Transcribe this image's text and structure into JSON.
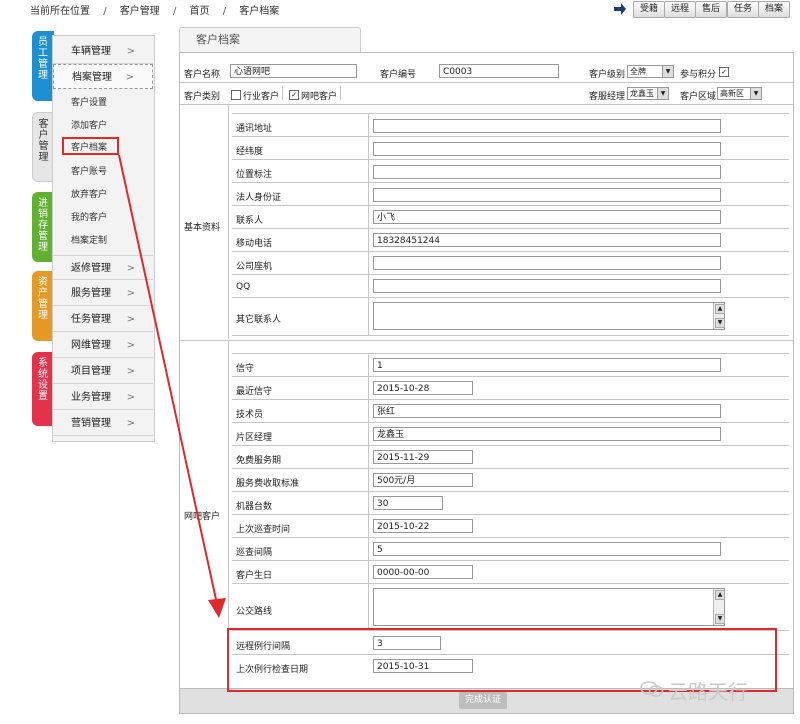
{
  "breadcrumb": {
    "location": "当前所在位置",
    "items": [
      "客户管理",
      "首页",
      "客户档案"
    ],
    "separator": "/"
  },
  "toolbar": {
    "buttons": [
      "受籍",
      "远程",
      "售后",
      "任务",
      "档案"
    ]
  },
  "side_tabs": [
    {
      "label": "员工管理",
      "color": "#1e8fd0"
    },
    {
      "label": "客户管理",
      "color": "#e6e6e6"
    },
    {
      "label": "进销存管理",
      "color": "#5fb12f"
    },
    {
      "label": "资产管理",
      "color": "#e49a25"
    },
    {
      "label": "系统设置",
      "color": "#e2334b"
    }
  ],
  "menu": {
    "top_items": [
      "车辆管理",
      "档案管理"
    ],
    "sub_items": [
      "客户设置",
      "添加客户",
      "客户档案",
      "客户账号",
      "放弃客户",
      "我的客户",
      "档案定制"
    ],
    "bottom_items": [
      "返修管理",
      "服务管理",
      "任务管理",
      "网维管理",
      "项目管理",
      "业务管理",
      "营销管理"
    ],
    "chevron": ">"
  },
  "panel": {
    "title": "客户档案",
    "header": {
      "name_label": "客户名称",
      "name_value": "心语网吧",
      "code_label": "客户编号",
      "code_value": "C0003",
      "level_label": "客户级别",
      "level_value": "全牌",
      "points_label": "参与积分",
      "points_checked": "✓",
      "type_label": "客户类别",
      "type_options": [
        "行业客户",
        "网吧客户"
      ],
      "type_checked": "✓",
      "manager_label": "客服经理",
      "manager_value": "龙鑫玉",
      "area_label": "客户区域",
      "area_value": "高新区"
    },
    "basic": {
      "section_label": "基本资料",
      "fields": [
        {
          "label": "通讯地址",
          "value": ""
        },
        {
          "label": "经纬度",
          "value": ""
        },
        {
          "label": "位置标注",
          "value": ""
        },
        {
          "label": "法人身份证",
          "value": ""
        },
        {
          "label": "联系人",
          "value": "小飞"
        },
        {
          "label": "移动电话",
          "value": "18328451244"
        },
        {
          "label": "公司座机",
          "value": ""
        },
        {
          "label": "QQ",
          "value": ""
        }
      ],
      "other_label": "其它联系人"
    },
    "netbar": {
      "section_label": "网吧客户",
      "fields": [
        {
          "label": "信守",
          "value": "1"
        },
        {
          "label": "最近信守",
          "value": "2015-10-28"
        },
        {
          "label": "技术员",
          "value": "张红"
        },
        {
          "label": "片区经理",
          "value": "龙鑫玉"
        },
        {
          "label": "免费服务期",
          "value": "2015-11-29"
        },
        {
          "label": "服务费收取标准",
          "value": "500元/月"
        },
        {
          "label": "机器台数",
          "value": "30"
        },
        {
          "label": "上次巡查时间",
          "value": "2015-10-22"
        },
        {
          "label": "巡查间隔",
          "value": "5"
        },
        {
          "label": "客户生日",
          "value": "0000-00-00"
        }
      ],
      "route_label": "公交路线",
      "remote_fields": [
        {
          "label": "远程例行间隔",
          "value": "3"
        },
        {
          "label": "上次例行检查日期",
          "value": "2015-10-31"
        }
      ]
    },
    "submit_label": "完成认证"
  },
  "watermark": "云路天行",
  "colors": {
    "highlight": "#e0292b"
  }
}
